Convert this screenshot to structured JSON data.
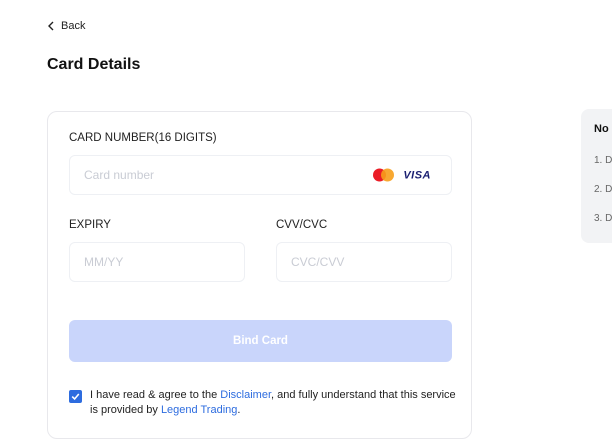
{
  "nav": {
    "back_label": "Back"
  },
  "page": {
    "title": "Card Details"
  },
  "form": {
    "card_number_label": "CARD NUMBER(16 DIGITS)",
    "card_number_placeholder": "Card number",
    "card_brands": [
      "mastercard-icon",
      "VISA"
    ],
    "expiry_label": "EXPIRY",
    "expiry_placeholder": "MM/YY",
    "cvv_label": "CVV/CVC",
    "cvv_placeholder": "CVC/CVV",
    "submit_label": "Bind Card",
    "agreement": {
      "checked": true,
      "text_1": "I have read & agree to the ",
      "disclaimer_link": "Disclaimer",
      "text_2": ", and fully understand that this service is provided by ",
      "company_link": "Legend Trading",
      "text_3": "."
    }
  },
  "notes": {
    "title": "No",
    "items": [
      "1. D",
      "2. D",
      "3. D"
    ]
  },
  "colors": {
    "accent": "#2d6cdf",
    "button_disabled": "#c9d5fb",
    "visa": "#1a1f71"
  }
}
